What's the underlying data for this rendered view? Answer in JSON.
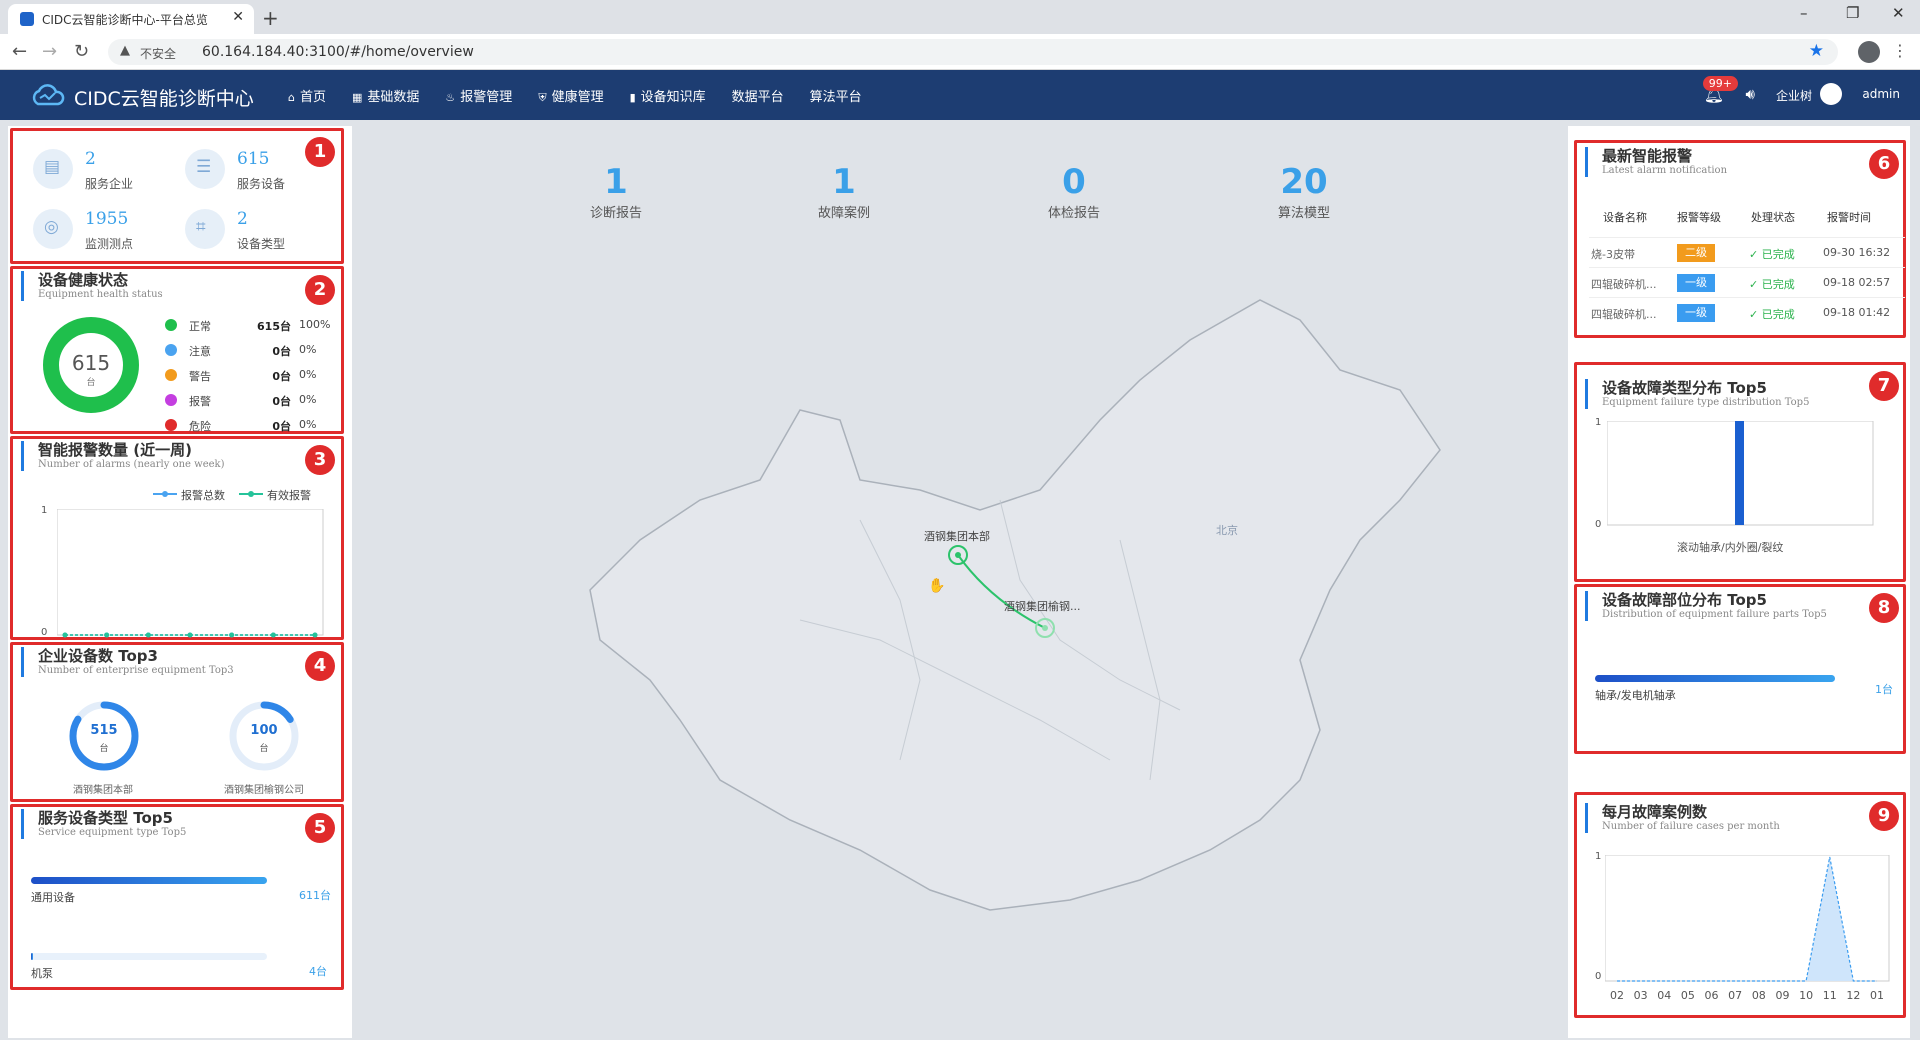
{
  "browser": {
    "tab_title": "CIDC云智能诊断中心-平台总览",
    "insecure_label": "不安全",
    "url": "60.164.184.40:3100/#/home/overview"
  },
  "header": {
    "app_title": "CIDC云智能诊断中心",
    "nav": [
      "首页",
      "基础数据",
      "报警管理",
      "健康管理",
      "设备知识库",
      "数据平台",
      "算法平台"
    ],
    "badge": "99+",
    "org_label": "企业树",
    "user": "admin"
  },
  "map_stats": [
    {
      "value": "1",
      "label": "诊断报告"
    },
    {
      "value": "1",
      "label": "故障案例"
    },
    {
      "value": "0",
      "label": "体检报告"
    },
    {
      "value": "20",
      "label": "算法模型"
    }
  ],
  "map": {
    "labels": {
      "city": "北京",
      "site_a": "酒钢集团本部",
      "site_b": "酒钢集团榆钢..."
    }
  },
  "annotations": [
    "1",
    "2",
    "3",
    "4",
    "5",
    "6",
    "7",
    "8",
    "9"
  ],
  "panel1": {
    "kpis": [
      {
        "value": "2",
        "label": "服务企业",
        "icon": "chart-icon"
      },
      {
        "value": "615",
        "label": "服务设备",
        "icon": "server-icon"
      },
      {
        "value": "1955",
        "label": "监测测点",
        "icon": "target-icon"
      },
      {
        "value": "2",
        "label": "设备类型",
        "icon": "grid-icon"
      }
    ]
  },
  "panel2": {
    "title": "设备健康状态",
    "subtitle": "Equipment health status",
    "total": "615",
    "unit": "台",
    "rows": [
      {
        "name": "正常",
        "count": "615台",
        "pct": "100%",
        "color": "#1fbf4c"
      },
      {
        "name": "注意",
        "count": "0台",
        "pct": "0%",
        "color": "#4aa3f0"
      },
      {
        "name": "警告",
        "count": "0台",
        "pct": "0%",
        "color": "#f29b1d"
      },
      {
        "name": "报警",
        "count": "0台",
        "pct": "0%",
        "color": "#c43ee0"
      },
      {
        "name": "危险",
        "count": "0台",
        "pct": "0%",
        "color": "#e02b2b"
      }
    ]
  },
  "panel3": {
    "title": "智能报警数量 (近一周)",
    "subtitle": "Number of alarms (nearly one week)",
    "legend": [
      "报警总数",
      "有效报警"
    ],
    "y_ticks": [
      "1",
      "0"
    ]
  },
  "panel4": {
    "title": "企业设备数 Top3",
    "subtitle": "Number of enterprise equipment Top3",
    "items": [
      {
        "value": "515",
        "unit": "台",
        "name": "酒钢集团本部",
        "fraction": 0.84
      },
      {
        "value": "100",
        "unit": "台",
        "name": "酒钢集团榆钢公司",
        "fraction": 0.16
      }
    ]
  },
  "panel5": {
    "title": "服务设备类型 Top5",
    "subtitle": "Service equipment type Top5",
    "items": [
      {
        "name": "通用设备",
        "value": "611台",
        "fraction": 1.0
      },
      {
        "name": "机泵",
        "value": "4台",
        "fraction": 0.01
      }
    ]
  },
  "panel6": {
    "title": "最新智能报警",
    "subtitle": "Latest alarm notification",
    "headers": [
      "设备名称",
      "报警等级",
      "处理状态",
      "报警时间"
    ],
    "rows": [
      {
        "name": "烧-3皮带",
        "level": "二级",
        "level_color": "#f29b1d",
        "status": "已完成",
        "time": "09-30 16:32"
      },
      {
        "name": "四辊破碎机...",
        "level": "一级",
        "level_color": "#3a9cf0",
        "status": "已完成",
        "time": "09-18 02:57"
      },
      {
        "name": "四辊破碎机...",
        "level": "一级",
        "level_color": "#3a9cf0",
        "status": "已完成",
        "time": "09-18 01:42"
      }
    ]
  },
  "panel7": {
    "title": "设备故障类型分布 Top5",
    "subtitle": "Equipment failure type distribution Top5",
    "y_ticks": [
      "1",
      "0"
    ],
    "category": "滚动轴承/内外圈/裂纹"
  },
  "panel8": {
    "title": "设备故障部位分布 Top5",
    "subtitle": "Distribution of equipment failure parts Top5",
    "items": [
      {
        "name": "轴承/发电机轴承",
        "value": "1台",
        "fraction": 1.0
      }
    ]
  },
  "panel9": {
    "title": "每月故障案例数",
    "subtitle": "Number of failure cases per month",
    "y_ticks": [
      "1",
      "0"
    ]
  },
  "chart_data": [
    {
      "type": "pie",
      "title": "设备健康状态",
      "categories": [
        "正常",
        "注意",
        "警告",
        "报警",
        "危险"
      ],
      "values": [
        615,
        0,
        0,
        0,
        0
      ]
    },
    {
      "type": "line",
      "title": "智能报警数量 (近一周)",
      "series": [
        {
          "name": "报警总数",
          "values": [
            0,
            0,
            0,
            0,
            0,
            0,
            0
          ]
        },
        {
          "name": "有效报警",
          "values": [
            0,
            0,
            0,
            0,
            0,
            0,
            0
          ]
        }
      ],
      "ylim": [
        0,
        1
      ]
    },
    {
      "type": "bar",
      "title": "设备故障类型分布 Top5",
      "categories": [
        "滚动轴承/内外圈/裂纹"
      ],
      "values": [
        1
      ],
      "ylim": [
        0,
        1
      ]
    },
    {
      "type": "area",
      "title": "每月故障案例数",
      "x": [
        "02",
        "03",
        "04",
        "05",
        "06",
        "07",
        "08",
        "09",
        "10",
        "11",
        "12",
        "01"
      ],
      "values": [
        0,
        0,
        0,
        0,
        0,
        0,
        0,
        0,
        0,
        1,
        0,
        0
      ],
      "ylim": [
        0,
        1
      ]
    }
  ]
}
